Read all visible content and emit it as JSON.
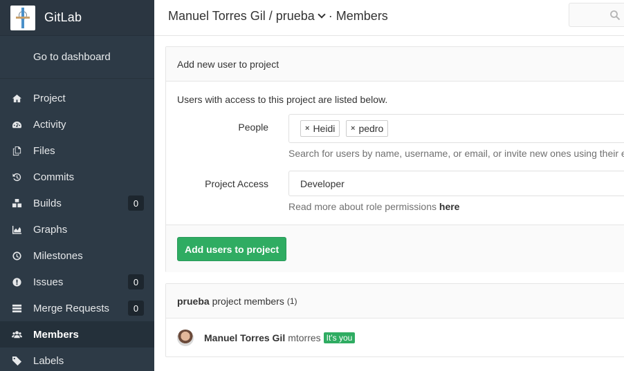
{
  "brand": {
    "name": "GitLab",
    "logo_icon": "gitlab-project-logo"
  },
  "sidebar": {
    "dashboard_label": "Go to dashboard",
    "items": [
      {
        "label": "Project",
        "icon": "home-icon"
      },
      {
        "label": "Activity",
        "icon": "dashboard-icon"
      },
      {
        "label": "Files",
        "icon": "files-icon"
      },
      {
        "label": "Commits",
        "icon": "history-icon"
      },
      {
        "label": "Builds",
        "icon": "cubes-icon",
        "badge": "0"
      },
      {
        "label": "Graphs",
        "icon": "area-chart-icon"
      },
      {
        "label": "Milestones",
        "icon": "clock-icon"
      },
      {
        "label": "Issues",
        "icon": "exclamation-circle-icon",
        "badge": "0"
      },
      {
        "label": "Merge Requests",
        "icon": "tasks-icon",
        "badge": "0"
      },
      {
        "label": "Members",
        "icon": "users-icon",
        "active": true
      },
      {
        "label": "Labels",
        "icon": "tags-icon"
      }
    ]
  },
  "header": {
    "breadcrumb": "Manuel Torres Gil / prueba",
    "separator": "·",
    "page": "Members",
    "search_icon": "search-icon"
  },
  "add_panel": {
    "title": "Add new user to project",
    "description": "Users with access to this project are listed below.",
    "people_label": "People",
    "people_tags": [
      "Heidi",
      "pedro"
    ],
    "tag_remove_glyph": "×",
    "people_help": "Search for users by name, username, or email, or invite new ones using their e",
    "access_label": "Project Access",
    "access_value": "Developer",
    "access_help_prefix": "Read more about role permissions",
    "access_help_link": "here",
    "submit_label": "Add users to project",
    "submit_color": "#2fac62"
  },
  "members_panel": {
    "project_name": "prueba",
    "title_suffix": "project members",
    "count": "(1)",
    "members": [
      {
        "name": "Manuel Torres Gil",
        "username": "mtorres",
        "badge": "It's you"
      }
    ]
  }
}
